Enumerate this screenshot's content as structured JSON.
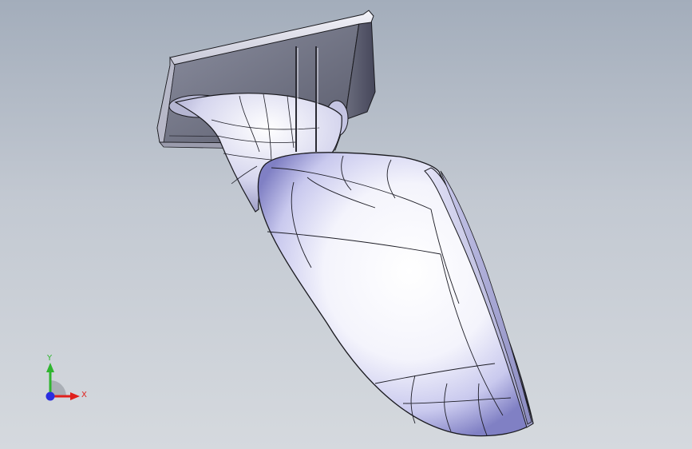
{
  "viewport": {
    "model": "mirror-assembly"
  },
  "triad": {
    "x_label": "X",
    "y_label": "Y",
    "x_color": "#e0201c",
    "y_color": "#2fb52f",
    "z_color": "#2a2ee0"
  },
  "colors": {
    "background_top": "#a3adbb",
    "background_bottom": "#d5d9de",
    "edge": "#1a1a1f"
  }
}
